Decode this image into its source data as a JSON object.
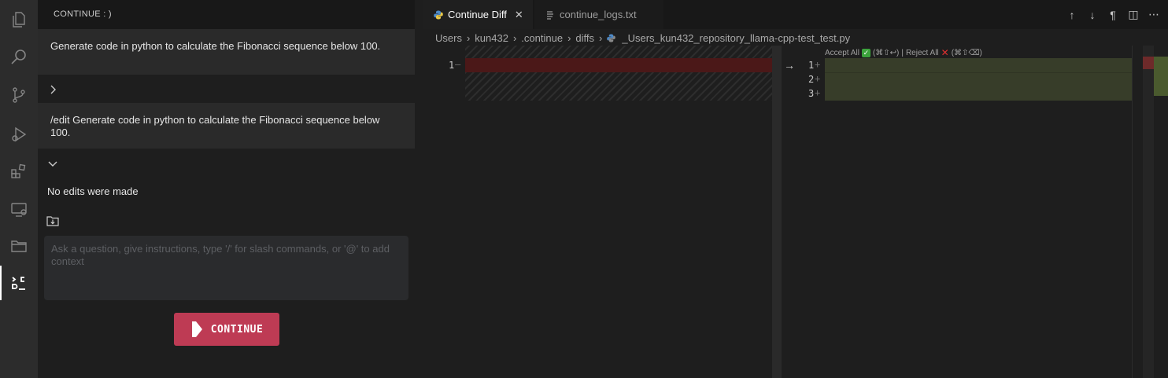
{
  "sidebar": {
    "header": "CONTINUE : )",
    "messages": [
      "Generate code in python to calculate the Fibonacci sequence below 100.",
      "/edit Generate code in python to calculate the Fibonacci sequence below 100."
    ],
    "no_edits": "No edits were made",
    "input_placeholder": "Ask a question, give instructions, type '/' for slash commands, or '@' to add context",
    "continue_button": "CONTINUE"
  },
  "tabs": [
    {
      "label": "Continue Diff",
      "active": true,
      "icon": "python-icon"
    },
    {
      "label": "continue_logs.txt",
      "active": false,
      "icon": "text-file-icon"
    }
  ],
  "breadcrumb": [
    "Users",
    "kun432",
    ".continue",
    "diffs",
    "_Users_kun432_repository_llama-cpp-test_test.py"
  ],
  "diff": {
    "left_line": "1",
    "left_mark": "—",
    "right_lines": [
      "1",
      "2",
      "3"
    ],
    "right_mark": "+",
    "codelens": {
      "accept": "Accept All",
      "accept_keys": "(⌘⇧↩)",
      "separator": "|",
      "reject": "Reject All",
      "reject_keys": "(⌘⇧⌫)"
    }
  },
  "colors": {
    "accent": "#be3b54",
    "removed": "#4b1818",
    "added": "#373d29"
  }
}
